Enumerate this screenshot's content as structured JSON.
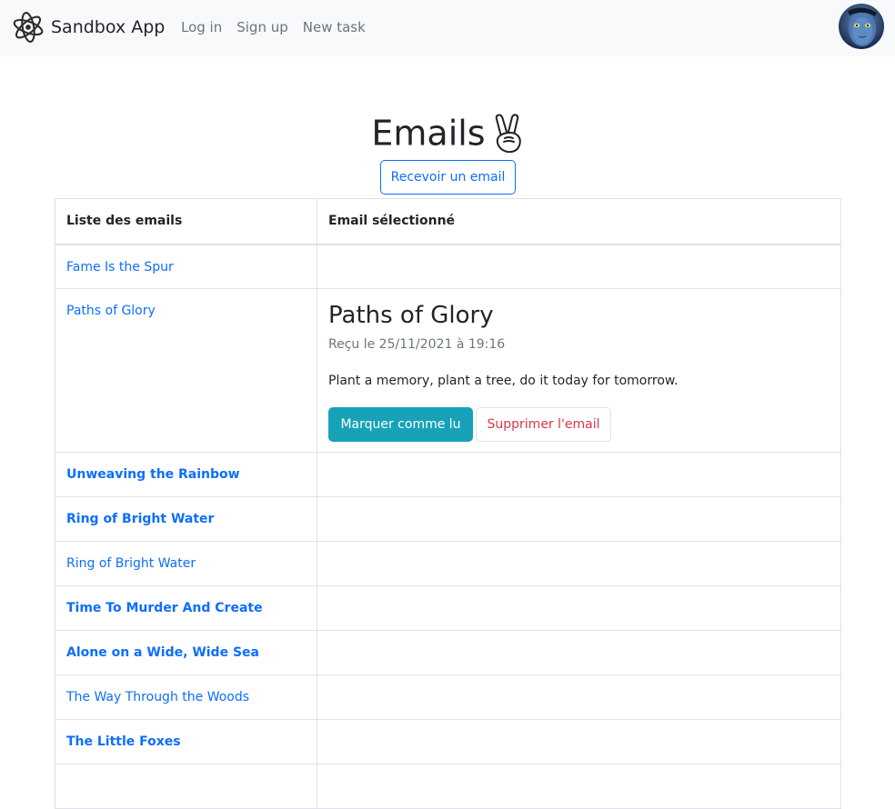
{
  "navbar": {
    "brand": "Sandbox App",
    "brand_icon": "atom-logo-icon",
    "links": [
      "Log in",
      "Sign up",
      "New task"
    ],
    "avatar_icon": "user-avatar-icon"
  },
  "page": {
    "title": "Emails",
    "title_icon": "victory-hand-icon",
    "receive_button": "Recevoir un email"
  },
  "table": {
    "headers": [
      "Liste des emails",
      "Email sélectionné"
    ],
    "emails": [
      {
        "subject": "Fame Is the Spur",
        "unread": false
      },
      {
        "subject": "Paths of Glory",
        "unread": false,
        "selected": true
      },
      {
        "subject": "Unweaving the Rainbow",
        "unread": true
      },
      {
        "subject": "Ring of Bright Water",
        "unread": true
      },
      {
        "subject": "Ring of Bright Water",
        "unread": false
      },
      {
        "subject": "Time To Murder And Create",
        "unread": true
      },
      {
        "subject": "Alone on a Wide, Wide Sea",
        "unread": true
      },
      {
        "subject": "The Way Through the Woods",
        "unread": false
      },
      {
        "subject": "The Little Foxes",
        "unread": true
      }
    ]
  },
  "selected_email": {
    "title": "Paths of Glory",
    "received": "Reçu le 25/11/2021 à 19:16",
    "body": "Plant a memory, plant a tree, do it today for tomorrow.",
    "mark_read_button": "Marquer comme lu",
    "delete_button": "Supprimer l'email"
  },
  "colors": {
    "primary": "#0d6efd",
    "info": "#17a2b8",
    "danger": "#dc3545",
    "muted": "#6c757d"
  }
}
